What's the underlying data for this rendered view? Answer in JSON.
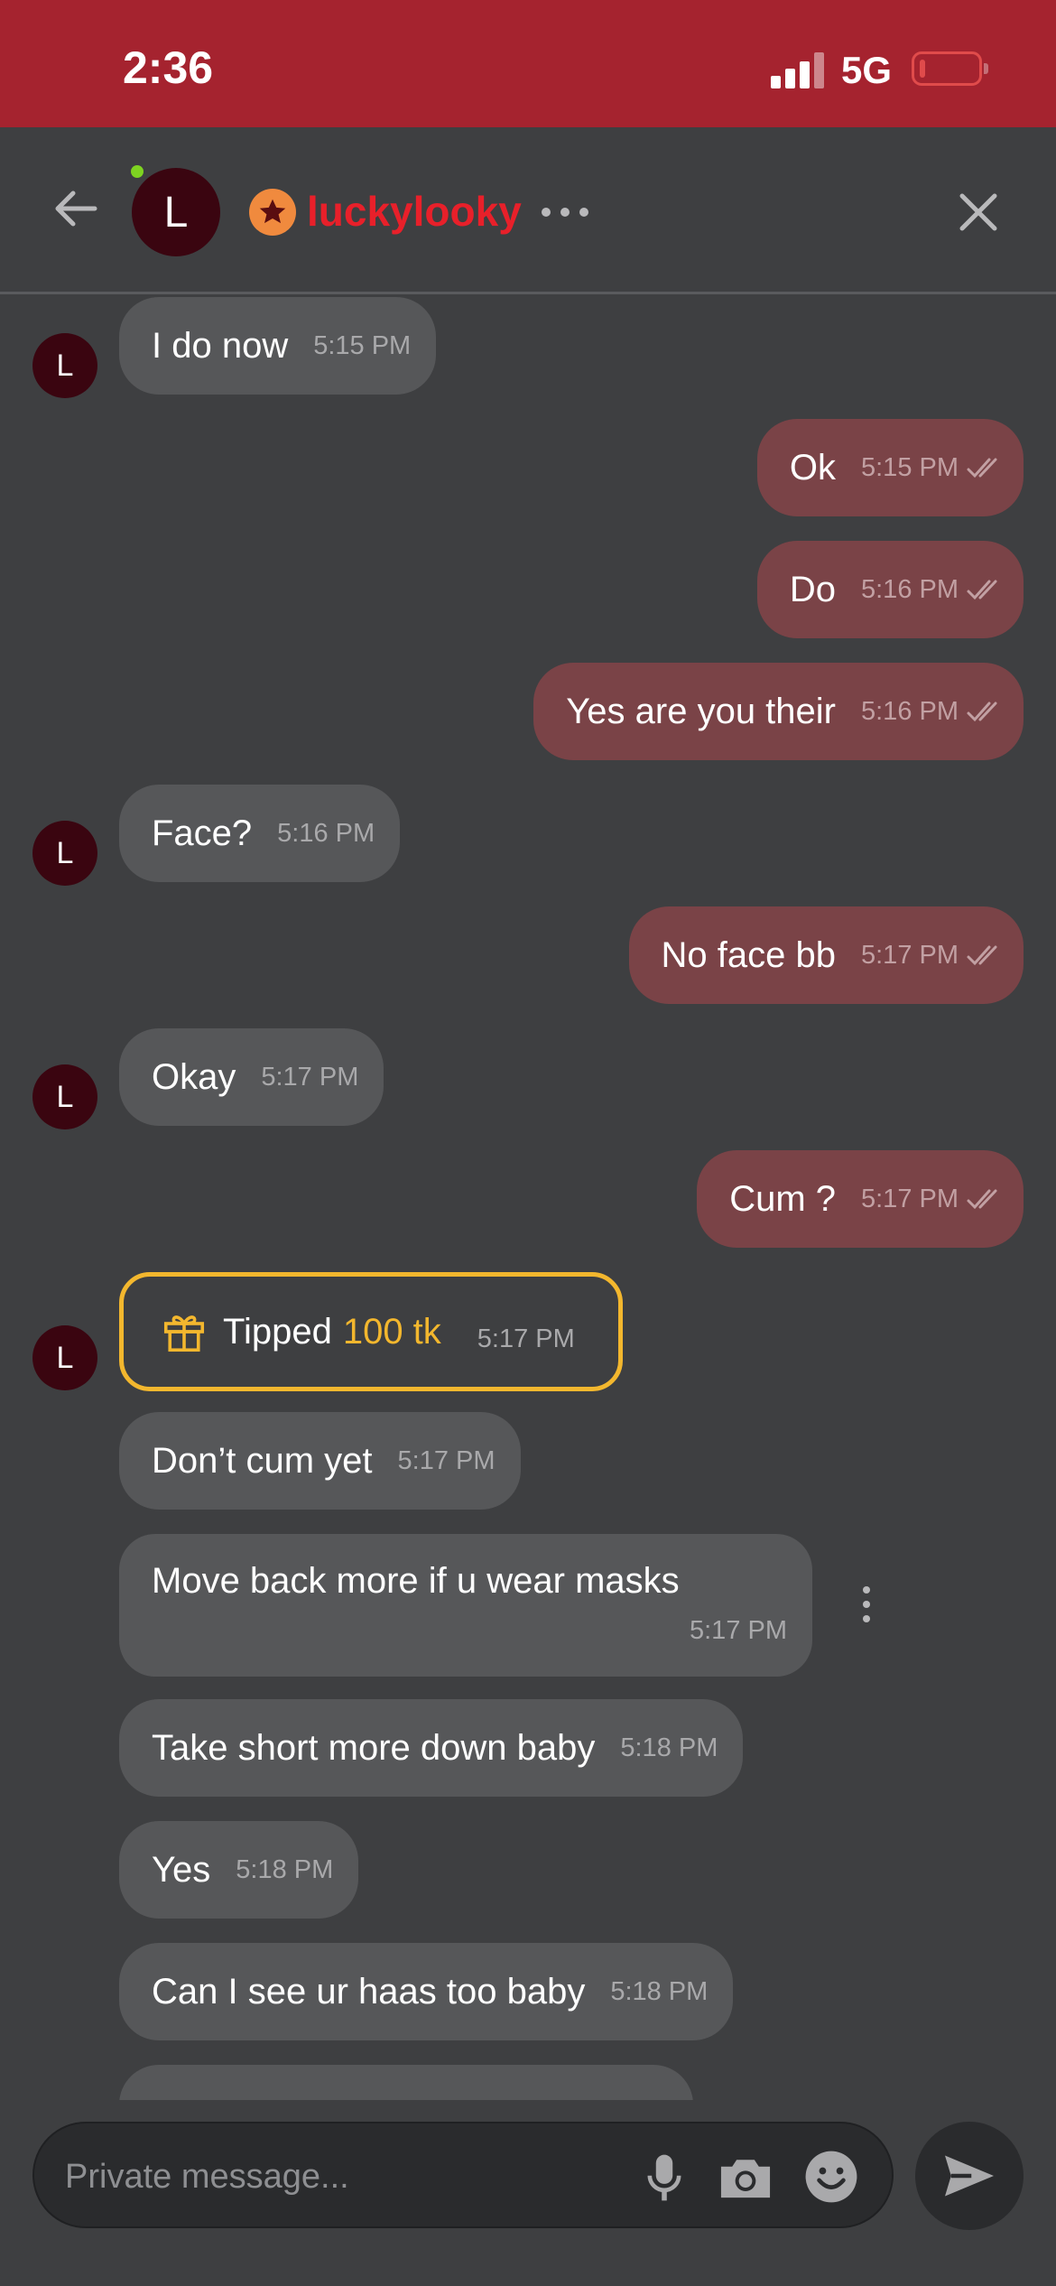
{
  "status_bar": {
    "time": "2:36",
    "network": "5G",
    "battery_level": 0.1
  },
  "header": {
    "avatar_letter": "L",
    "username": "luckylooky",
    "online": true
  },
  "messages": [
    {
      "direction": "in",
      "text": "I do now",
      "time": "5:15 PM",
      "avatar": "L"
    },
    {
      "direction": "out",
      "text": "Ok",
      "time": "5:15 PM"
    },
    {
      "direction": "out",
      "text": "Do",
      "time": "5:16 PM"
    },
    {
      "direction": "out",
      "text": "Yes are you their",
      "time": "5:16 PM"
    },
    {
      "direction": "in",
      "text": "Face?",
      "time": "5:16 PM",
      "avatar": "L"
    },
    {
      "direction": "out",
      "text": "No face bb",
      "time": "5:17 PM"
    },
    {
      "direction": "in",
      "text": "Okay",
      "time": "5:17 PM",
      "avatar": "L"
    },
    {
      "direction": "out",
      "text": "Cum ?",
      "time": "5:17 PM"
    },
    {
      "direction": "in",
      "type": "tip",
      "label": "Tipped",
      "amount": "100 tk",
      "time": "5:17 PM",
      "avatar": "L"
    },
    {
      "direction": "in",
      "text": "Don’t cum yet",
      "time": "5:17 PM"
    },
    {
      "direction": "in",
      "text": "Move back more if u wear masks",
      "time": "5:17 PM"
    },
    {
      "direction": "in",
      "text": "Take short more down baby",
      "time": "5:18 PM"
    },
    {
      "direction": "in",
      "text": "Yes",
      "time": "5:18 PM"
    },
    {
      "direction": "in",
      "text": "Can I see ur haas too baby",
      "time": "5:18 PM"
    }
  ],
  "composer": {
    "placeholder": "Private message..."
  },
  "colors": {
    "status_bar": "#a5232f",
    "username": "#e8202a",
    "outgoing_bubble": "#7a4347",
    "incoming_bubble": "#565759",
    "tip_accent": "#f3b72e",
    "online": "#7ed321"
  },
  "icons": [
    "back-arrow-icon",
    "star-badge-icon",
    "more-horizontal-icon",
    "close-icon",
    "double-check-icon",
    "gift-icon",
    "more-vertical-icon",
    "microphone-icon",
    "camera-icon",
    "emoji-icon",
    "send-icon"
  ]
}
